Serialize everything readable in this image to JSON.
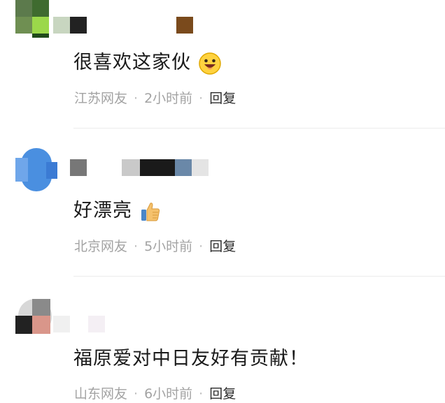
{
  "comments": [
    {
      "text": "很喜欢这家伙",
      "location": "江苏网友",
      "time": "2小时前",
      "reply": "回复",
      "emoji": "grinning-face-icon"
    },
    {
      "text": "好漂亮",
      "location": "北京网友",
      "time": "5小时前",
      "reply": "回复",
      "emoji": "thumbs-up-icon"
    },
    {
      "text": "福原爱对中日友好有贡献！",
      "location": "山东网友",
      "time": "6小时前",
      "reply": "回复",
      "emoji": ""
    }
  ],
  "separator": "·",
  "colors": {
    "meta": "#a3a3a3",
    "reply": "#2b2b2b",
    "divider": "#ececec"
  }
}
